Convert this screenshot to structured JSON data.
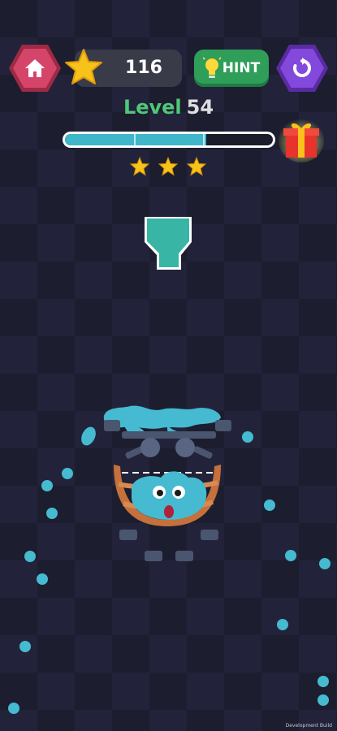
{
  "score": "116",
  "hint": {
    "label": "HINT"
  },
  "level": {
    "word": "Level",
    "number": "54"
  },
  "progress": {
    "fraction": 0.68
  },
  "stars_earned": 3,
  "footer": {
    "build_label": "Development Build"
  },
  "colors": {
    "water": "#3fb6ca",
    "level_word": "#4fc77a",
    "home": "#d5456a",
    "restart": "#8348dc",
    "hint": "#2f9e59"
  },
  "icons": [
    "home-icon",
    "star-icon",
    "lightbulb-icon",
    "restart-icon",
    "gift-icon"
  ]
}
